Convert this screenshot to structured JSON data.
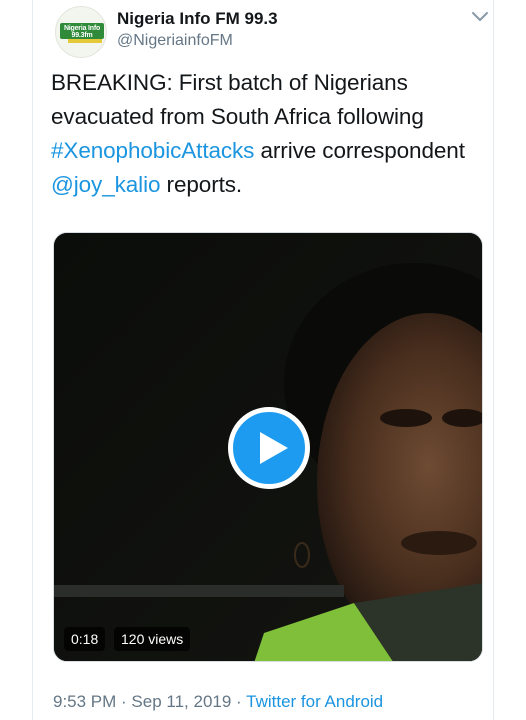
{
  "account": {
    "display_name": "Nigeria Info FM 99.3",
    "handle": "@NigeriainfoFM",
    "avatar_text": "Nigeria Info 99.3fm",
    "avatar_colors": {
      "badge": "#2f8a3a",
      "accent": "#e4c93a"
    }
  },
  "tweet": {
    "text_part1": "BREAKING: First batch of Nigerians evacuated from South Africa following ",
    "hashtag": "#XenophobicAttacks",
    "text_part2": " arrive correspondent ",
    "mention": "@joy_kalio",
    "text_part3": " reports."
  },
  "video": {
    "duration": "0:18",
    "views": "120 views",
    "play_icon": "play-icon"
  },
  "footer": {
    "time": "9:53 PM",
    "separator1": " · ",
    "date": "Sep 11, 2019",
    "separator2": " · ",
    "source": "Twitter for Android"
  },
  "colors": {
    "link": "#1b95e0",
    "secondary_text": "#657786",
    "primary_text": "#14171a",
    "play_button": "#1d9bf0"
  },
  "icons": {
    "menu": "chevron-down-icon"
  }
}
